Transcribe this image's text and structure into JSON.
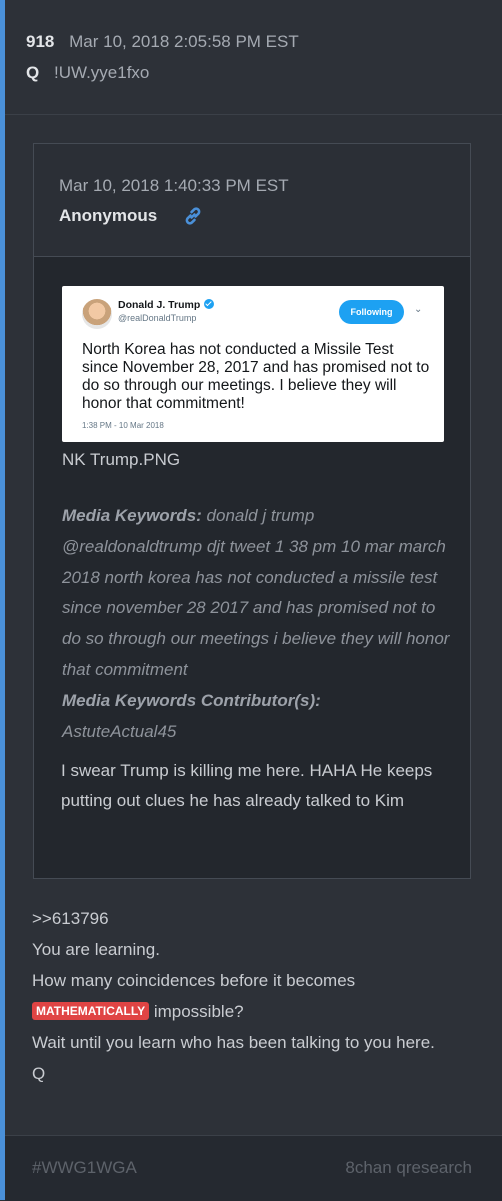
{
  "post": {
    "number": "918",
    "date": "Mar 10, 2018 2:05:58 PM EST",
    "author": "Q",
    "tripcode": "!UW.yye1fxo"
  },
  "quoted": {
    "date": "Mar 10, 2018 1:40:33 PM EST",
    "author": "Anonymous",
    "link_icon": "link-icon",
    "tweet": {
      "name": "Donald J. Trump",
      "handle": "@realDonaldTrump",
      "follow_label": "Following",
      "text": "North Korea has not conducted a Missile Test since November 28, 2017 and has promised not to do so through our meetings. I believe they will honor that commitment!",
      "timestamp": "1:38 PM - 10 Mar 2018"
    },
    "image_name": "NK Trump.PNG",
    "keywords_label": "Media Keywords:",
    "keywords": "donald j trump @realdonaldtrump djt tweet 1 38 pm 10 mar march 2018 north korea has not conducted a missile test since november 28 2017 and has promised not to do so through our meetings i believe they will honor that commitment",
    "contributor_label": "Media Keywords Contributor(s):",
    "contributor": "AstuteActual45",
    "message": "I swear Trump is killing me here. HAHA He keeps putting out clues he has already talked to Kim"
  },
  "body": {
    "line1": ">>613796",
    "line2": "You are learning.",
    "line3": "How many coincidences before it becomes",
    "highlight": "MATHEMATICALLY",
    "line4_rest": " impossible?",
    "line5": "Wait until you learn who has been talking to you here.",
    "line6": "Q"
  },
  "footer": {
    "hashtag": "#WWG1WGA",
    "source": "8chan qresearch"
  },
  "colors": {
    "accent": "#4a90d9",
    "link": "#4a90d9",
    "highlight_bg": "#e04444",
    "twitter_blue": "#1da1f2"
  }
}
